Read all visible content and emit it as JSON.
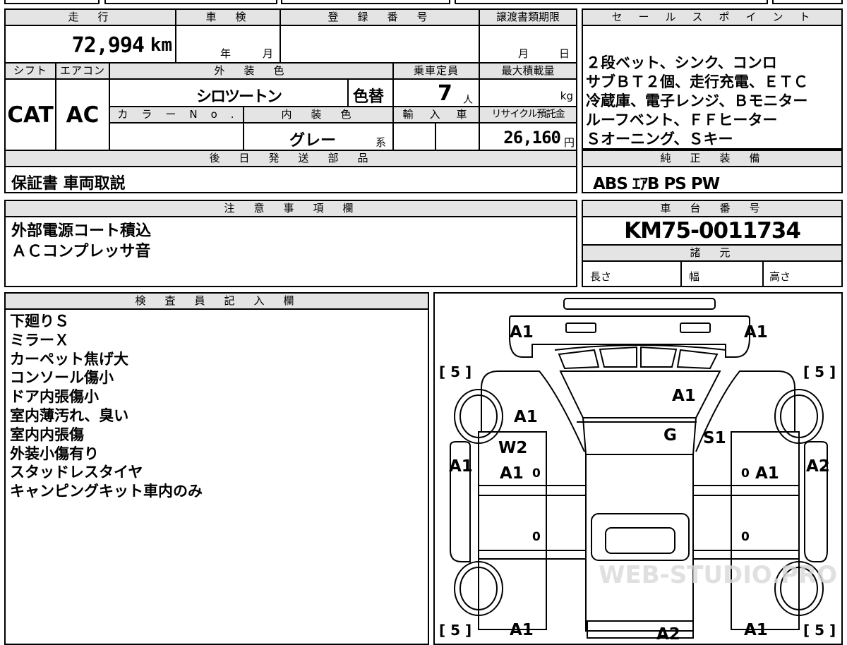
{
  "top_form": {
    "mileage_label": "走　行",
    "inspection_label": "車　検",
    "reg_no_label": "登　録　番　号",
    "transfer_label": "譲渡書類期限",
    "mileage_value": "72,994",
    "mileage_unit": "km",
    "year_label": "年",
    "month_label": "月",
    "transfer_month": "月",
    "transfer_day": "日",
    "shift_label": "シフト",
    "ac_label": "エアコン",
    "exterior_label": "外　装　色",
    "capacity_label": "乗車定員",
    "max_load_label": "最大積載量",
    "shift_value": "CAT",
    "ac_value": "AC",
    "exterior_value": "シロツートン",
    "color_change": "色替",
    "capacity_value": "7",
    "capacity_unit": "人",
    "load_unit": "kg",
    "color_no_label": "カ　ラ　ー　N　o　.",
    "interior_label": "内　装　色",
    "import_label": "輸　入　車",
    "recycle_label": "リサイクル預託金",
    "interior_value": "グレー",
    "interior_suffix": "系",
    "recycle_value": "26,160",
    "recycle_unit": "円",
    "later_parts_label": "後　日　発　送　部　品",
    "later_parts_value": "保証書 車両取説"
  },
  "sales_points": {
    "label": "セ　ー　ル　ス　ポ　イ　ン　ト",
    "lines": [
      "２段ベット、シンク、コンロ",
      "サブＢＴ２個、走行充電、ＥＴＣ",
      "冷蔵庫、電子レンジ、Ｂモニター",
      "ルーフベント、ＦＦヒーター",
      "Ｓオーニング、Ｓキー"
    ]
  },
  "equipment": {
    "label": "純　正　装　備",
    "value": "ABS ｴｱB PS PW"
  },
  "notes": {
    "label": "注　意　事　項　欄",
    "lines": [
      "外部電源コート積込",
      "ＡＣコンプレッサ音"
    ]
  },
  "chassis": {
    "label": "車　台　番　号",
    "value": "KM75-0011734",
    "specs_label": "諸　元",
    "length_label": "長さ",
    "width_label": "幅",
    "height_label": "高さ"
  },
  "inspector": {
    "label": "検　査　員　記　入　欄",
    "lines": [
      "下廻りＳ",
      "ミラーＸ",
      "カーペット焦げ大",
      "コンソール傷小",
      "ドア内張傷小",
      "室内薄汚れ、臭い",
      "室内内張傷",
      "外装小傷有り",
      "スタッドレスタイヤ",
      "キャンピングキット車内のみ"
    ]
  },
  "diagram": {
    "tire_marks": [
      "[ 5 ]",
      "[ 5 ]",
      "[ 5 ]",
      "[ 5 ]"
    ],
    "marks": [
      "A1",
      "A1",
      "A1",
      "A1",
      "A1",
      "G",
      "S1",
      "W2",
      "A1",
      "A1",
      "A1",
      "A2",
      "A1",
      "A2",
      "A1"
    ],
    "zeros": [
      "0",
      "0",
      "0",
      "0"
    ],
    "watermark": "WEB-STUDIO.PRO"
  }
}
